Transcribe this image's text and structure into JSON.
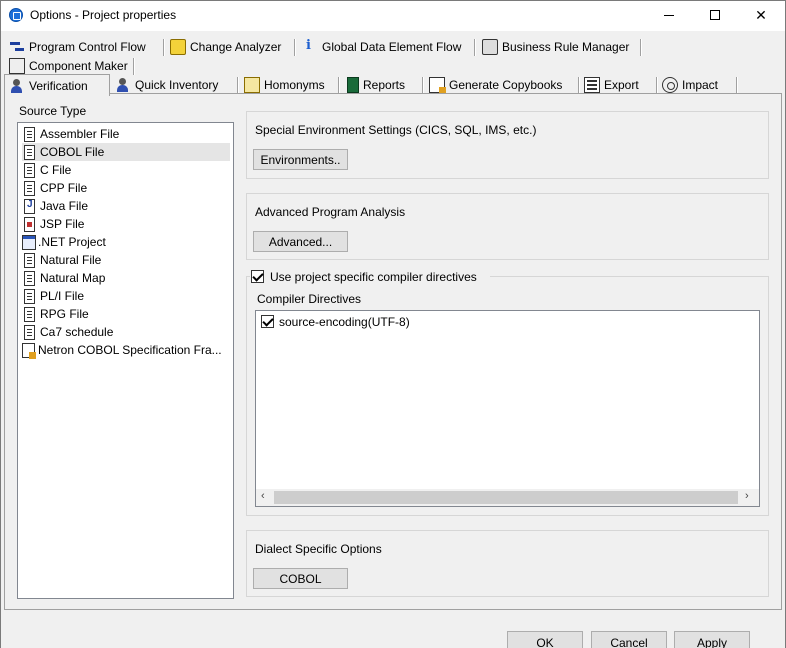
{
  "window": {
    "title": "Options - Project properties",
    "controls": {
      "minimize": "minimize",
      "maximize": "maximize",
      "close": "✕"
    }
  },
  "tabs_row1": [
    {
      "label": "Program Control Flow",
      "icon": "flow-icon"
    },
    {
      "label": "Change Analyzer",
      "icon": "change-analyzer-icon"
    },
    {
      "label": "Global Data Element Flow",
      "icon": "info-icon"
    },
    {
      "label": "Business Rule Manager",
      "icon": "briefcase-icon"
    }
  ],
  "tabs_row2": [
    {
      "label": "Component Maker",
      "icon": "component-icon"
    }
  ],
  "tabs_row3": [
    {
      "label": "Verification",
      "icon": "user-icon",
      "active": true
    },
    {
      "label": "Quick Inventory",
      "icon": "user-icon"
    },
    {
      "label": "Homonyms",
      "icon": "homonyms-icon"
    },
    {
      "label": "Reports",
      "icon": "report-icon"
    },
    {
      "label": "Generate Copybooks",
      "icon": "generate-icon"
    },
    {
      "label": "Export",
      "icon": "export-icon"
    },
    {
      "label": "Impact",
      "icon": "impact-icon"
    }
  ],
  "source_type": {
    "label": "Source Type",
    "items": [
      "Assembler File",
      "COBOL File",
      "C File",
      "CPP File",
      "Java File",
      "JSP File",
      ".NET Project",
      "Natural File",
      "Natural Map",
      "PL/I File",
      "RPG File",
      "Ca7 schedule",
      "Netron COBOL Specification Fra..."
    ],
    "selected": "COBOL File"
  },
  "special_env": {
    "label": "Special Environment Settings (CICS, SQL, IMS, etc.)",
    "button": "Environments.."
  },
  "advanced": {
    "label": "Advanced Program Analysis",
    "button": "Advanced..."
  },
  "compiler": {
    "use_specific_label": "Use project specific compiler directives",
    "use_specific_checked": true,
    "directives_label": "Compiler Directives",
    "directives": [
      {
        "text": "source-encoding(UTF-8)",
        "checked": true
      }
    ],
    "scroll_left": "‹",
    "scroll_right": "›"
  },
  "dialect": {
    "label": "Dialect Specific Options",
    "button": "COBOL"
  },
  "footer": {
    "ok": "OK",
    "cancel": "Cancel",
    "apply": "Apply"
  }
}
